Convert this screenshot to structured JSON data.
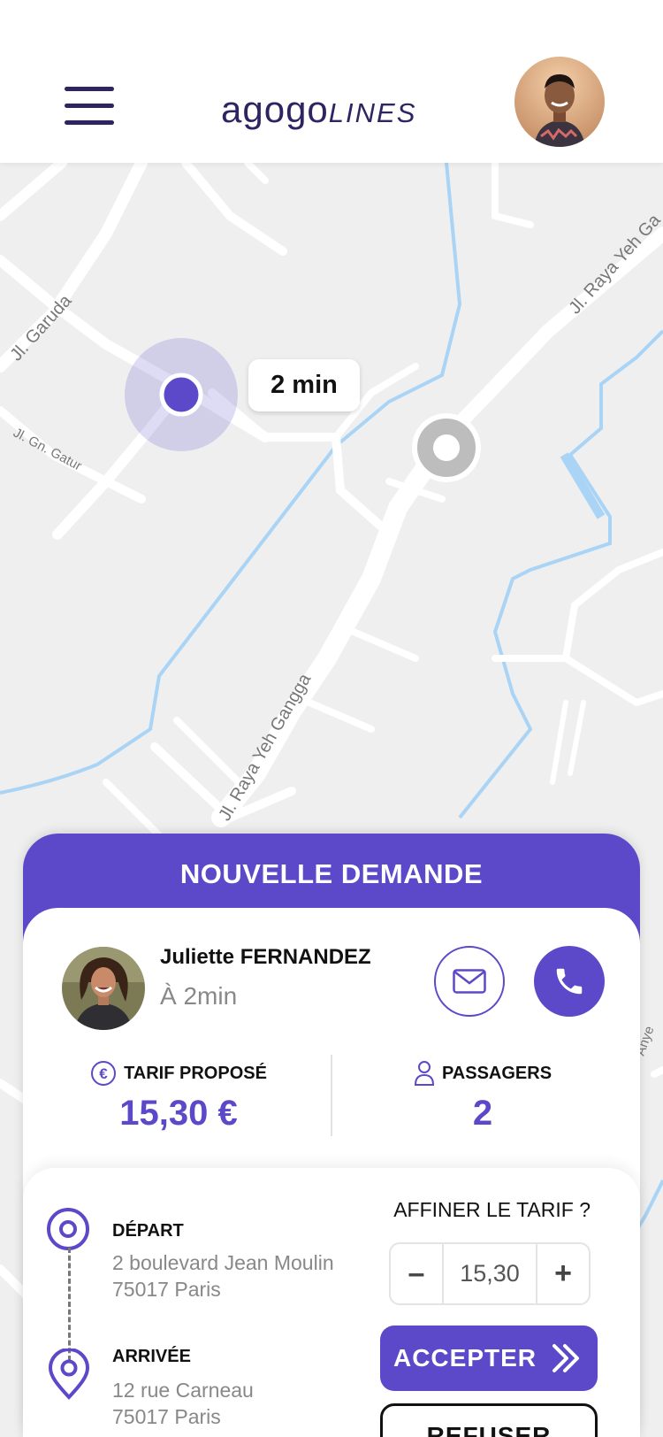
{
  "header": {
    "logo_main": "agogo",
    "logo_sub": "LINES",
    "menu_icon": "hamburger-menu-icon",
    "profile_avatar": "driver-avatar"
  },
  "map": {
    "streets": [
      "Jl. Garuda",
      "Jl. Gn. Gatur",
      "Jl. Raya Yeh Ga",
      "Jl. Raya Yeh Gangga",
      "Anye"
    ],
    "eta_label": "2 min"
  },
  "request": {
    "title": "NOUVELLE DEMANDE",
    "client_name": "Juliette FERNANDEZ",
    "client_eta": "À 2min",
    "mail_icon": "mail-icon",
    "phone_icon": "phone-icon",
    "tarif_label": "TARIF PROPOSÉ",
    "tarif_value": "15,30 €",
    "passengers_label": "PASSAGERS",
    "passengers_value": "2"
  },
  "route": {
    "departure_label": "DÉPART",
    "departure_line1": "2 boulevard Jean Moulin",
    "departure_line2": "75017 Paris",
    "arrival_label": "ARRIVÉE",
    "arrival_line1": "12 rue Carneau",
    "arrival_line2": "75017 Paris"
  },
  "actions": {
    "refine_label": "AFFINER LE TARIF ?",
    "minus_label": "–",
    "plus_label": "+",
    "fare_value": "15,30",
    "accept_label": "ACCEPTER",
    "refuse_label": "REFUSER"
  },
  "colors": {
    "accent": "#5b49c9",
    "dark": "#2d2461",
    "river": "#a9d4f5"
  }
}
